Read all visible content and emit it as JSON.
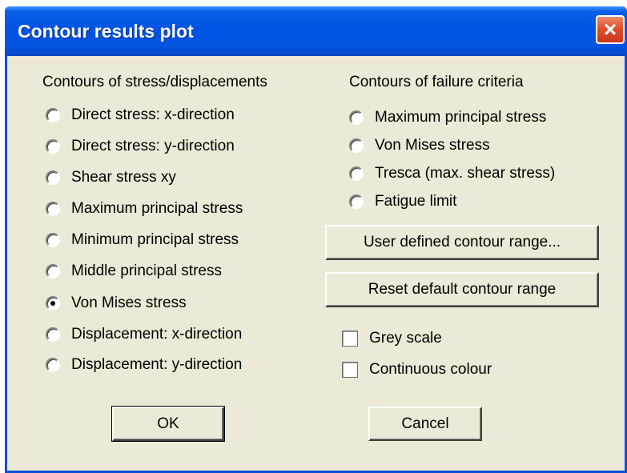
{
  "window": {
    "title": "Contour results plot"
  },
  "left_group": {
    "heading": "Contours of stress/displacements",
    "options": [
      {
        "label": "Direct stress: x-direction",
        "selected": false
      },
      {
        "label": "Direct stress: y-direction",
        "selected": false
      },
      {
        "label": "Shear stress xy",
        "selected": false
      },
      {
        "label": "Maximum principal stress",
        "selected": false
      },
      {
        "label": "Minimum principal stress",
        "selected": false
      },
      {
        "label": "Middle principal stress",
        "selected": false
      },
      {
        "label": "Von Mises stress",
        "selected": true
      },
      {
        "label": "Displacement: x-direction",
        "selected": false
      },
      {
        "label": "Displacement: y-direction",
        "selected": false
      }
    ]
  },
  "right_group": {
    "heading": "Contours of failure criteria",
    "options": [
      {
        "label": "Maximum principal stress",
        "selected": false
      },
      {
        "label": "Von Mises stress",
        "selected": false
      },
      {
        "label": "Tresca (max. shear stress)",
        "selected": false
      },
      {
        "label": "Fatigue limit",
        "selected": false
      }
    ]
  },
  "buttons": {
    "user_range": "User defined contour range...",
    "reset_range": "Reset default contour range",
    "ok": "OK",
    "cancel": "Cancel"
  },
  "checkboxes": [
    {
      "label": "Grey scale",
      "checked": false
    },
    {
      "label": "Continuous colour",
      "checked": false
    }
  ],
  "colors": {
    "titlebar": "#0054e3",
    "dialog_bg": "#ece9d8",
    "close_button": "#e0502b"
  }
}
